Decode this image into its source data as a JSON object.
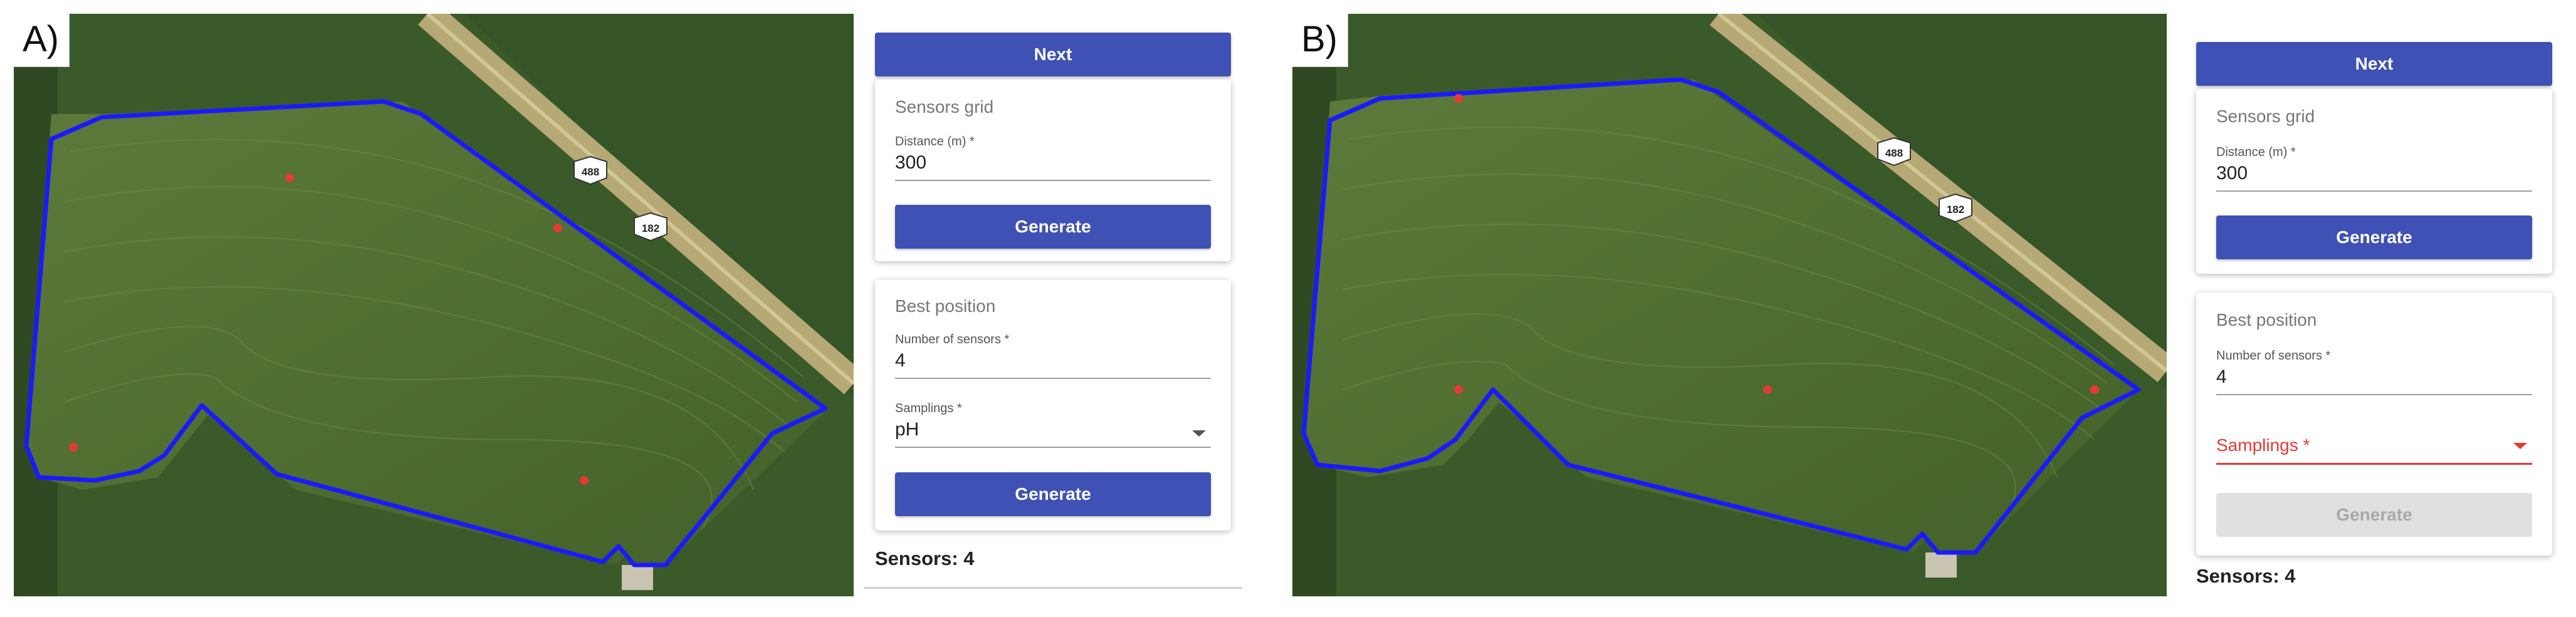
{
  "panels": [
    {
      "letter": "A)",
      "next_label": "Next",
      "grid_card": {
        "title": "Sensors grid",
        "distance_label": "Distance (m) *",
        "distance_value": "300",
        "generate_label": "Generate"
      },
      "best_card": {
        "title": "Best position",
        "num_label": "Number of sensors *",
        "num_value": "4",
        "samplings_label": "Samplings *",
        "samplings_value": "pH",
        "generate_label": "Generate"
      },
      "sensors_text": "Sensors: 4",
      "road_shields": [
        "488",
        "182"
      ]
    },
    {
      "letter": "B)",
      "next_label": "Next",
      "grid_card": {
        "title": "Sensors grid",
        "distance_label": "Distance (m) *",
        "distance_value": "300",
        "generate_label": "Generate"
      },
      "best_card": {
        "title": "Best position",
        "num_label": "Number of sensors *",
        "num_value": "4",
        "samplings_label": "Samplings *",
        "generate_label": "Generate"
      },
      "sensors_text": "Sensors: 4",
      "road_shields": [
        "488",
        "182"
      ]
    }
  ],
  "colors": {
    "primary_button": "#3f51b5",
    "boundary": "#1a1aff",
    "sensor_marker": "#e53935",
    "error": "#e53935",
    "disabled_button": "#e0e0e0"
  },
  "icons": {
    "dropdown": "chevron-down-icon",
    "sensor": "sensor-marker-icon",
    "road": "road-shield-icon"
  }
}
